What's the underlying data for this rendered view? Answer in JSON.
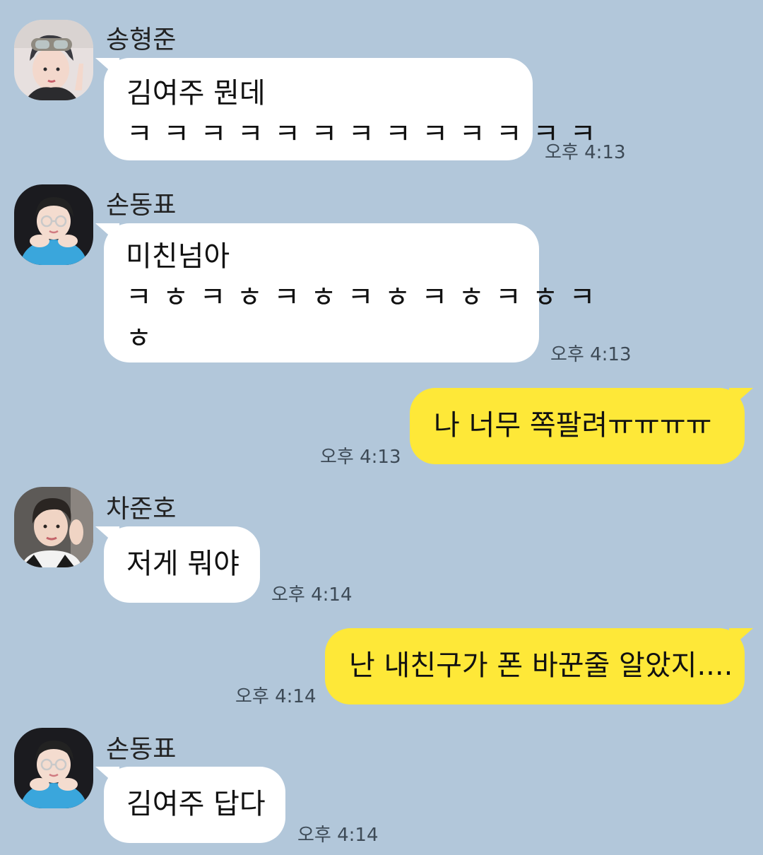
{
  "messages": [
    {
      "sender": "송형준",
      "lines": [
        "김여주 뭔데",
        "ㅋㅋㅋㅋㅋㅋㅋㅋㅋㅋㅋㅋㅋ"
      ],
      "time": "오후 4:13"
    },
    {
      "sender": "손동표",
      "lines": [
        "미친넘아",
        "ㅋㅎㅋㅎㅋㅎㅋㅎㅋㅎㅋㅎㅋ",
        "ㅎ"
      ],
      "time": "오후 4:13"
    },
    {
      "sender": "",
      "lines": [
        "나 너무 쪽팔려ㅠㅠㅠㅠ"
      ],
      "time": "오후 4:13"
    },
    {
      "sender": "차준호",
      "lines": [
        "저게 뭐야"
      ],
      "time": "오후 4:14"
    },
    {
      "sender": "",
      "lines": [
        "난 내친구가 폰 바꾼줄 알았지...."
      ],
      "time": "오후 4:14"
    },
    {
      "sender": "손동표",
      "lines": [
        "김여주 답다"
      ],
      "time": "오후 4:14"
    }
  ],
  "colors": {
    "background": "#b2c7da",
    "incoming_bubble": "#ffffff",
    "outgoing_bubble": "#fee838"
  }
}
